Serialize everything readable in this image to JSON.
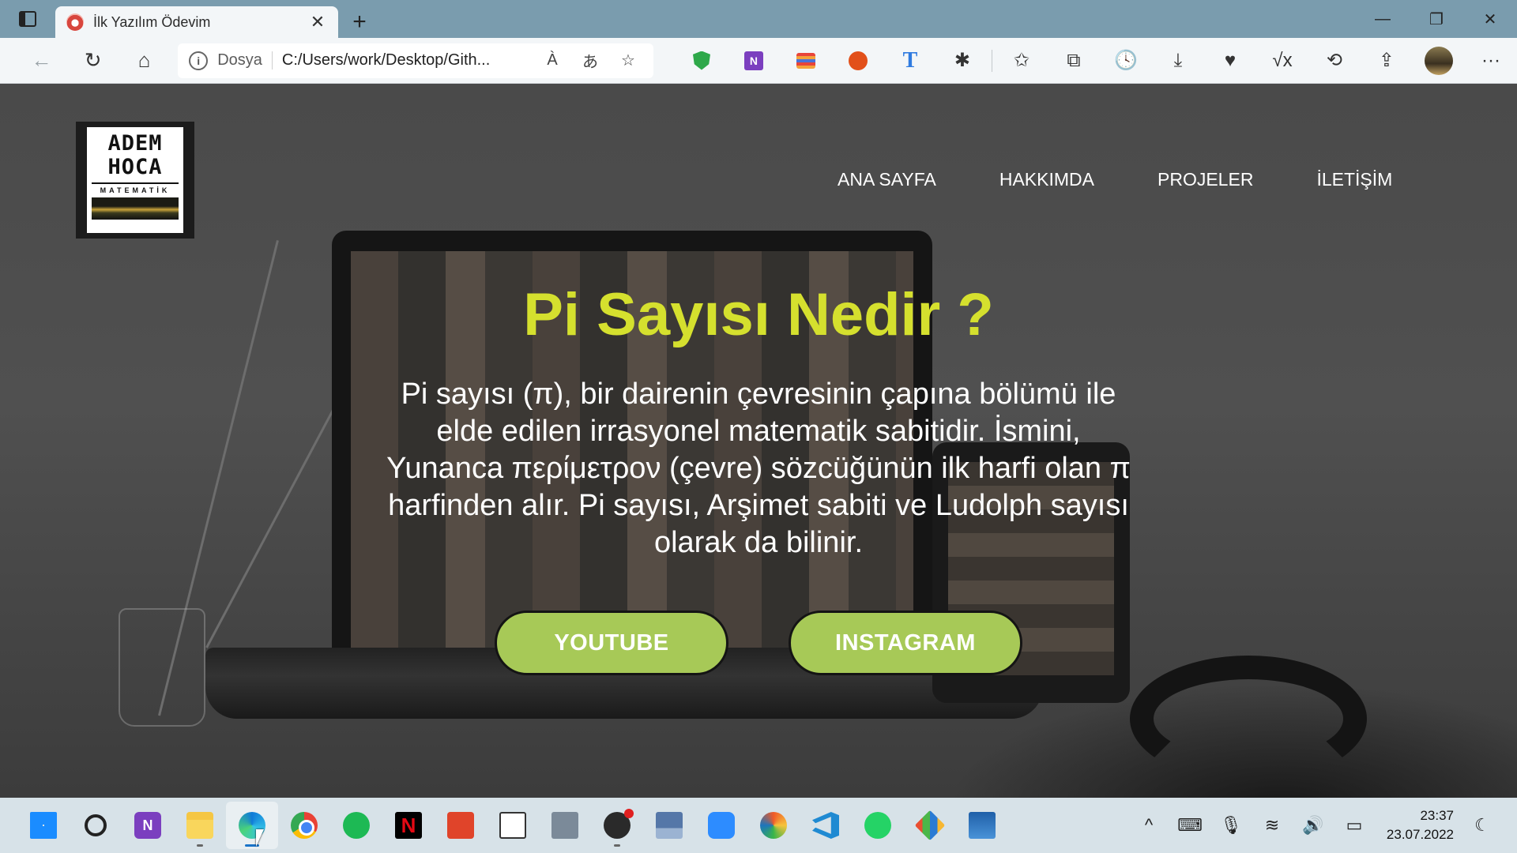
{
  "browser": {
    "tab": {
      "title": "İlk Yazılım Ödevim",
      "close": "✕"
    },
    "new_tab": "+",
    "window": {
      "minimize": "—",
      "restore": "❐",
      "close": "✕"
    },
    "nav": {
      "back": "←",
      "refresh": "↻",
      "home": "⌂"
    },
    "address": {
      "info": "i",
      "scheme": "Dosya",
      "url": "C:/Users/work/Desktop/Gith...",
      "read_aloud": "À",
      "translate": "あ",
      "favorite": "☆"
    },
    "toolbar_icons": {
      "extensions": "✱",
      "favorites": "✩",
      "collections": "⧉",
      "history": "🕓",
      "downloads": "⤓",
      "health": "♥",
      "math": "√x",
      "performance": "⟲",
      "share": "⇪",
      "more": "···"
    }
  },
  "site": {
    "logo": {
      "line1": "ADEM",
      "line2": "HOCA",
      "line3": "MATEMATİK"
    },
    "nav": [
      "ANA SAYFA",
      "HAKKIMDA",
      "PROJELER",
      "İLETİŞİM"
    ],
    "hero": {
      "title": "Pi Sayısı Nedir ?",
      "text": "Pi sayısı (π), bir dairenin çevresinin çapına bölümü ile elde edilen irrasyonel matematik sabitidir. İsmini, Yunanca περίμετρον (çevre) sözcüğünün ilk harfi olan π harfinden alır. Pi sayısı, Arşimet sabiti ve Ludolph sayısı olarak da bilinir."
    },
    "buttons": {
      "youtube": "YOUTUBE",
      "instagram": "INSTAGRAM"
    }
  },
  "taskbar": {
    "onenote_label": "N",
    "netflix_label": "N",
    "tray": {
      "chevron": "^",
      "keyboard": "⌨",
      "mic": "🎙",
      "wifi": "≋",
      "volume": "🔊",
      "battery": "▭",
      "focus": "☾"
    },
    "clock": {
      "time": "23:37",
      "date": "23.07.2022"
    }
  },
  "colors": {
    "accent_title": "#d5e02e",
    "button_bg": "#a7c957",
    "tabbar": "#7a9cae",
    "taskbar": "#d7e2e8"
  }
}
